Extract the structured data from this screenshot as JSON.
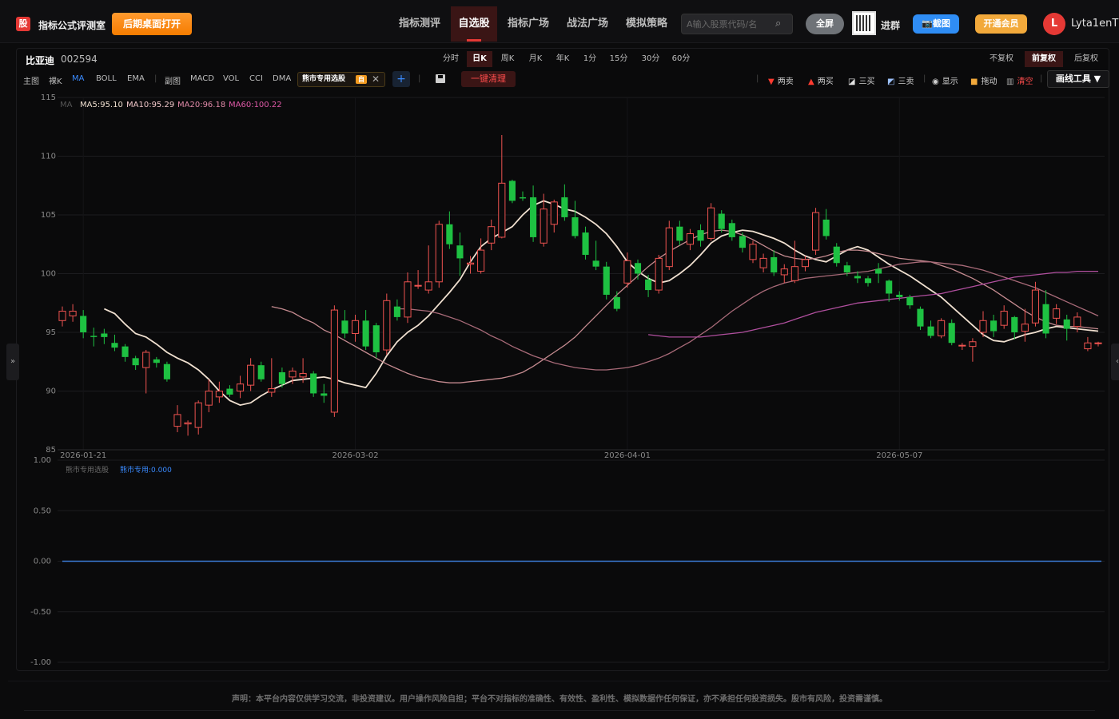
{
  "header": {
    "logo": "股",
    "app_title": "指标公式评测室",
    "open_desktop": "后期桌面打开",
    "nav": [
      "指标测评",
      "自选股",
      "指标广场",
      "战法广场",
      "模拟策略"
    ],
    "search_placeholder": "A输入股票代码/名",
    "fullscreen": "全屏",
    "join_group": "进群",
    "screenshot": "截图",
    "vip": "开通会员",
    "avatar_letter": "L",
    "username": "Lyta1enT"
  },
  "stock": {
    "name": "比亚迪",
    "code": "002594"
  },
  "periods": [
    "分时",
    "日K",
    "周K",
    "月K",
    "年K",
    "1分",
    "15分",
    "30分",
    "60分"
  ],
  "adjust": [
    "不复权",
    "前复权",
    "后复权"
  ],
  "indicators": {
    "main_label": "主图",
    "main": [
      "裸K",
      "MA",
      "BOLL",
      "EMA"
    ],
    "sub_label": "副图",
    "sub": [
      "MACD",
      "VOL",
      "CCI",
      "DMA"
    ],
    "custom_tag": "熊市专用选股",
    "custom_self": "自",
    "clear_all": "一键清理"
  },
  "tools": {
    "two_sell": "两卖",
    "two_buy": "两买",
    "three_buy": "三买",
    "three_sell": "三卖",
    "show": "显示",
    "drag": "拖动",
    "clear": "清空",
    "draw_tools": "画线工具 ▼"
  },
  "ma_legend": {
    "prefix": "MA",
    "ma5": "MA5:95.10",
    "ma10": "MA10:95.29",
    "ma20": "MA20:96.18",
    "ma60": "MA60:100.22"
  },
  "sub_legend": {
    "name": "熊市专用选股",
    "value": "熊市专用:0.000"
  },
  "colors": {
    "up": "#ef5350",
    "down": "#1ec142",
    "ma5": "#f0e0d0",
    "ma10": "#c58b90",
    "ma20": "#a86a78",
    "ma60": "#b04f9e",
    "sub_line": "#3a7bd5"
  },
  "disclaimer": "声明：本平台内容仅供学习交流，非投资建议。用户操作风险自担；平台不对指标的准确性、有效性、盈利性、模拟数据作任何保证，亦不承担任何投资损失。股市有风险，投资需谨慎。",
  "chart_data": [
    {
      "type": "candlestick",
      "title": "",
      "ylim": [
        85,
        115
      ],
      "yticks": [
        85,
        90,
        95,
        100,
        105,
        110,
        115
      ],
      "x_tick_labels": [
        "2026-01-21",
        "2026-03-02",
        "2026-04-01",
        "2026-05-07"
      ],
      "x_tick_index": [
        2,
        28,
        54,
        80
      ],
      "candles": [
        [
          96.0,
          96.8,
          95.5,
          97.2
        ],
        [
          96.4,
          96.8,
          95.9,
          97.4
        ],
        [
          96.4,
          95.0,
          94.5,
          96.9
        ],
        [
          94.7,
          94.6,
          93.8,
          95.4
        ],
        [
          94.9,
          94.6,
          94.0,
          95.3
        ],
        [
          94.1,
          93.7,
          93.4,
          94.8
        ],
        [
          93.8,
          92.9,
          92.5,
          94.0
        ],
        [
          92.8,
          92.2,
          91.8,
          93.0
        ],
        [
          92.0,
          93.3,
          89.8,
          93.5
        ],
        [
          92.7,
          92.4,
          92.0,
          92.9
        ],
        [
          92.3,
          91.0,
          90.8,
          92.5
        ],
        [
          87.0,
          88.0,
          86.5,
          88.8
        ],
        [
          87.2,
          87.3,
          86.2,
          87.5
        ],
        [
          86.9,
          89.0,
          86.3,
          89.2
        ],
        [
          88.8,
          90.0,
          88.2,
          91.0
        ],
        [
          89.5,
          90.0,
          89.0,
          90.8
        ],
        [
          90.2,
          89.7,
          89.5,
          90.5
        ],
        [
          90.0,
          90.6,
          89.4,
          91.3
        ],
        [
          90.5,
          92.2,
          90.0,
          92.8
        ],
        [
          92.2,
          91.0,
          90.8,
          92.5
        ],
        [
          89.9,
          90.2,
          89.5,
          92.8
        ],
        [
          91.6,
          90.6,
          90.3,
          92.0
        ],
        [
          91.2,
          91.7,
          90.6,
          92.0
        ],
        [
          91.2,
          91.5,
          90.7,
          92.8
        ],
        [
          91.5,
          89.8,
          89.5,
          91.7
        ],
        [
          89.8,
          89.6,
          89.0,
          90.6
        ],
        [
          88.2,
          96.9,
          87.8,
          97.3
        ],
        [
          96.0,
          94.9,
          94.5,
          96.9
        ],
        [
          94.9,
          96.0,
          94.2,
          96.5
        ],
        [
          96.0,
          93.8,
          93.5,
          96.9
        ],
        [
          95.6,
          93.3,
          92.8,
          95.8
        ],
        [
          93.5,
          97.7,
          93.1,
          98.3
        ],
        [
          97.2,
          96.3,
          96.0,
          97.8
        ],
        [
          96.3,
          99.3,
          95.8,
          100.1
        ],
        [
          99.0,
          99.0,
          98.7,
          100.3
        ],
        [
          98.6,
          99.3,
          98.3,
          102.4
        ],
        [
          99.3,
          104.2,
          98.8,
          104.5
        ],
        [
          104.2,
          102.5,
          102.1,
          105.3
        ],
        [
          102.4,
          101.3,
          99.8,
          103.5
        ],
        [
          100.8,
          100.9,
          100.0,
          101.5
        ],
        [
          100.2,
          102.0,
          100.0,
          103.0
        ],
        [
          102.6,
          104.0,
          102.0,
          104.6
        ],
        [
          103.1,
          107.7,
          103.0,
          111.8
        ],
        [
          107.9,
          106.2,
          106.0,
          108.0
        ],
        [
          106.5,
          106.4,
          106.2,
          107.0
        ],
        [
          106.5,
          103.1,
          102.7,
          107.5
        ],
        [
          102.6,
          105.5,
          102.3,
          106.8
        ],
        [
          104.2,
          106.1,
          103.5,
          106.3
        ],
        [
          106.5,
          104.8,
          104.5,
          107.6
        ],
        [
          104.8,
          103.2,
          103.0,
          106.2
        ],
        [
          103.5,
          101.6,
          101.2,
          104.0
        ],
        [
          101.1,
          100.6,
          100.3,
          102.8
        ],
        [
          100.6,
          98.2,
          97.8,
          101.0
        ],
        [
          98.0,
          97.0,
          96.8,
          98.5
        ],
        [
          99.2,
          101.1,
          98.8,
          101.8
        ],
        [
          100.9,
          100.0,
          99.5,
          101.2
        ],
        [
          99.5,
          98.6,
          98.0,
          99.9
        ],
        [
          98.6,
          101.3,
          98.3,
          101.6
        ],
        [
          100.6,
          103.9,
          100.3,
          104.5
        ],
        [
          104.0,
          102.8,
          102.4,
          104.5
        ],
        [
          102.5,
          103.4,
          102.0,
          103.8
        ],
        [
          103.7,
          102.8,
          102.3,
          104.2
        ],
        [
          103.0,
          105.6,
          102.8,
          106.0
        ],
        [
          105.1,
          103.8,
          103.5,
          105.4
        ],
        [
          104.3,
          103.1,
          102.8,
          104.6
        ],
        [
          103.2,
          102.2,
          101.8,
          103.5
        ],
        [
          101.2,
          102.5,
          100.9,
          102.8
        ],
        [
          100.5,
          101.3,
          100.1,
          101.7
        ],
        [
          101.4,
          100.1,
          99.8,
          102.0
        ],
        [
          99.9,
          100.4,
          99.2,
          100.8
        ],
        [
          99.4,
          100.6,
          99.2,
          102.8
        ],
        [
          100.6,
          101.2,
          100.2,
          101.5
        ],
        [
          102.0,
          105.2,
          101.6,
          105.6
        ],
        [
          104.6,
          103.2,
          102.9,
          105.5
        ],
        [
          102.3,
          100.9,
          100.6,
          102.6
        ],
        [
          100.7,
          100.1,
          99.8,
          101.0
        ],
        [
          99.8,
          99.6,
          99.2,
          100.2
        ],
        [
          99.6,
          99.2,
          98.9,
          99.8
        ],
        [
          100.4,
          100.0,
          99.2,
          100.9
        ],
        [
          99.4,
          98.3,
          97.6,
          99.5
        ],
        [
          98.2,
          98.0,
          97.7,
          98.5
        ],
        [
          98.0,
          97.3,
          97.0,
          98.2
        ],
        [
          97.0,
          95.5,
          95.2,
          97.2
        ],
        [
          95.5,
          94.7,
          94.5,
          96.0
        ],
        [
          94.7,
          96.0,
          94.5,
          96.2
        ],
        [
          95.8,
          94.1,
          93.9,
          96.1
        ],
        [
          93.9,
          93.9,
          93.5,
          94.1
        ],
        [
          93.8,
          94.2,
          92.5,
          94.5
        ],
        [
          95.0,
          96.0,
          94.6,
          96.8
        ],
        [
          96.0,
          95.1,
          94.6,
          96.5
        ],
        [
          95.6,
          96.8,
          95.3,
          97.3
        ],
        [
          96.3,
          95.0,
          94.4,
          96.4
        ],
        [
          95.1,
          95.7,
          94.2,
          97.0
        ],
        [
          95.8,
          98.6,
          95.5,
          99.3
        ],
        [
          97.4,
          94.9,
          94.5,
          98.6
        ],
        [
          96.2,
          97.0,
          95.7,
          97.4
        ],
        [
          96.1,
          95.3,
          94.3,
          96.5
        ],
        [
          95.5,
          96.3,
          95.0,
          96.7
        ],
        [
          93.6,
          94.1,
          93.4,
          94.6
        ],
        [
          94.1,
          94.1,
          93.8,
          94.2
        ]
      ],
      "ma_series": {
        "MA5": [
          97.0,
          96.6,
          95.7,
          94.9,
          94.6,
          94.0,
          93.3,
          92.8,
          92.4,
          91.8,
          91.0,
          90.0,
          89.2,
          88.8,
          89.0,
          89.6,
          90.1,
          90.5,
          90.9,
          91.0,
          91.1,
          91.2,
          91.0,
          90.7,
          90.5,
          90.3,
          91.5,
          93.0,
          94.2,
          95.0,
          95.6,
          96.4,
          97.4,
          98.4,
          99.5,
          101.0,
          102.3,
          103.0,
          103.5,
          104.0,
          105.0,
          105.8,
          106.2,
          105.9,
          105.5,
          105.3,
          104.8,
          104.2,
          103.4,
          102.3,
          101.0,
          100.2,
          99.6,
          99.2,
          99.4,
          100.0,
          100.7,
          101.6,
          102.6,
          103.2,
          103.5,
          103.7,
          103.6,
          103.3,
          103.0,
          102.6,
          102.0,
          101.5,
          101.2,
          101.0,
          101.5,
          102.0,
          102.3,
          102.0,
          101.4,
          100.8,
          100.3,
          99.8,
          99.2,
          98.6,
          98.0,
          97.2,
          96.4,
          95.6,
          94.8,
          94.3,
          94.2,
          94.5,
          94.8,
          95.0,
          95.3,
          95.5,
          95.4,
          95.3,
          95.2,
          95.1
        ],
        "MA10": [
          97.2,
          97.0,
          96.7,
          96.2,
          95.8,
          95.2,
          94.8,
          94.3,
          93.8,
          93.3,
          92.8,
          92.3,
          91.9,
          91.5,
          91.2,
          91.0,
          90.8,
          90.7,
          90.7,
          90.8,
          90.9,
          91.0,
          91.1,
          91.3,
          91.6,
          92.1,
          92.7,
          93.3,
          93.9,
          94.6,
          95.5,
          96.4,
          97.3,
          98.2,
          99.0,
          99.8,
          100.6,
          101.3,
          101.9,
          102.4,
          102.9,
          103.3,
          103.6,
          103.7,
          103.6,
          103.3,
          102.9,
          102.4,
          101.9,
          101.5,
          101.3,
          101.2,
          101.3,
          101.5,
          101.8,
          102.0,
          102.0,
          101.9,
          101.7,
          101.5,
          101.3,
          101.2,
          101.1,
          101.0,
          100.7,
          100.4,
          100.0,
          99.6,
          99.1,
          98.6,
          98.0,
          97.4,
          96.8,
          96.3,
          95.9,
          95.6,
          95.5,
          95.5,
          95.4,
          95.3
        ],
        "MA20": [
          97.0,
          97.0,
          96.9,
          96.8,
          96.6,
          96.3,
          96.0,
          95.6,
          95.2,
          94.7,
          94.3,
          93.8,
          93.4,
          93.0,
          92.7,
          92.4,
          92.2,
          92.0,
          91.9,
          91.8,
          91.8,
          91.9,
          92.0,
          92.2,
          92.5,
          92.8,
          93.2,
          93.7,
          94.2,
          94.8,
          95.4,
          96.1,
          96.8,
          97.4,
          98.0,
          98.5,
          98.9,
          99.2,
          99.4,
          99.6,
          99.7,
          99.8,
          99.9,
          100.0,
          100.1,
          100.2,
          100.4,
          100.6,
          100.8,
          100.9,
          101.0,
          101.0,
          100.9,
          100.8,
          100.7,
          100.5,
          100.3,
          100.0,
          99.7,
          99.4,
          99.1,
          98.8,
          98.4,
          98.0,
          97.6,
          97.2,
          96.8,
          96.4
        ],
        "MA60": [
          94.8,
          94.7,
          94.6,
          94.6,
          94.6,
          94.6,
          94.7,
          94.8,
          94.9,
          95.0,
          95.2,
          95.4,
          95.6,
          95.8,
          96.1,
          96.4,
          96.7,
          96.9,
          97.1,
          97.3,
          97.5,
          97.6,
          97.7,
          97.8,
          97.9,
          98.0,
          98.1,
          98.2,
          98.3,
          98.5,
          98.7,
          98.9,
          99.1,
          99.3,
          99.5,
          99.7,
          99.8,
          99.9,
          100.0,
          100.1,
          100.1,
          100.2,
          100.2,
          100.2
        ]
      }
    },
    {
      "type": "line",
      "title": "熊市专用选股",
      "ylim": [
        -1.0,
        1.0
      ],
      "yticks": [
        1.0,
        0.5,
        0.0,
        -0.5,
        -1.0
      ],
      "series": [
        {
          "name": "熊市专用",
          "value": 0.0
        }
      ]
    }
  ]
}
